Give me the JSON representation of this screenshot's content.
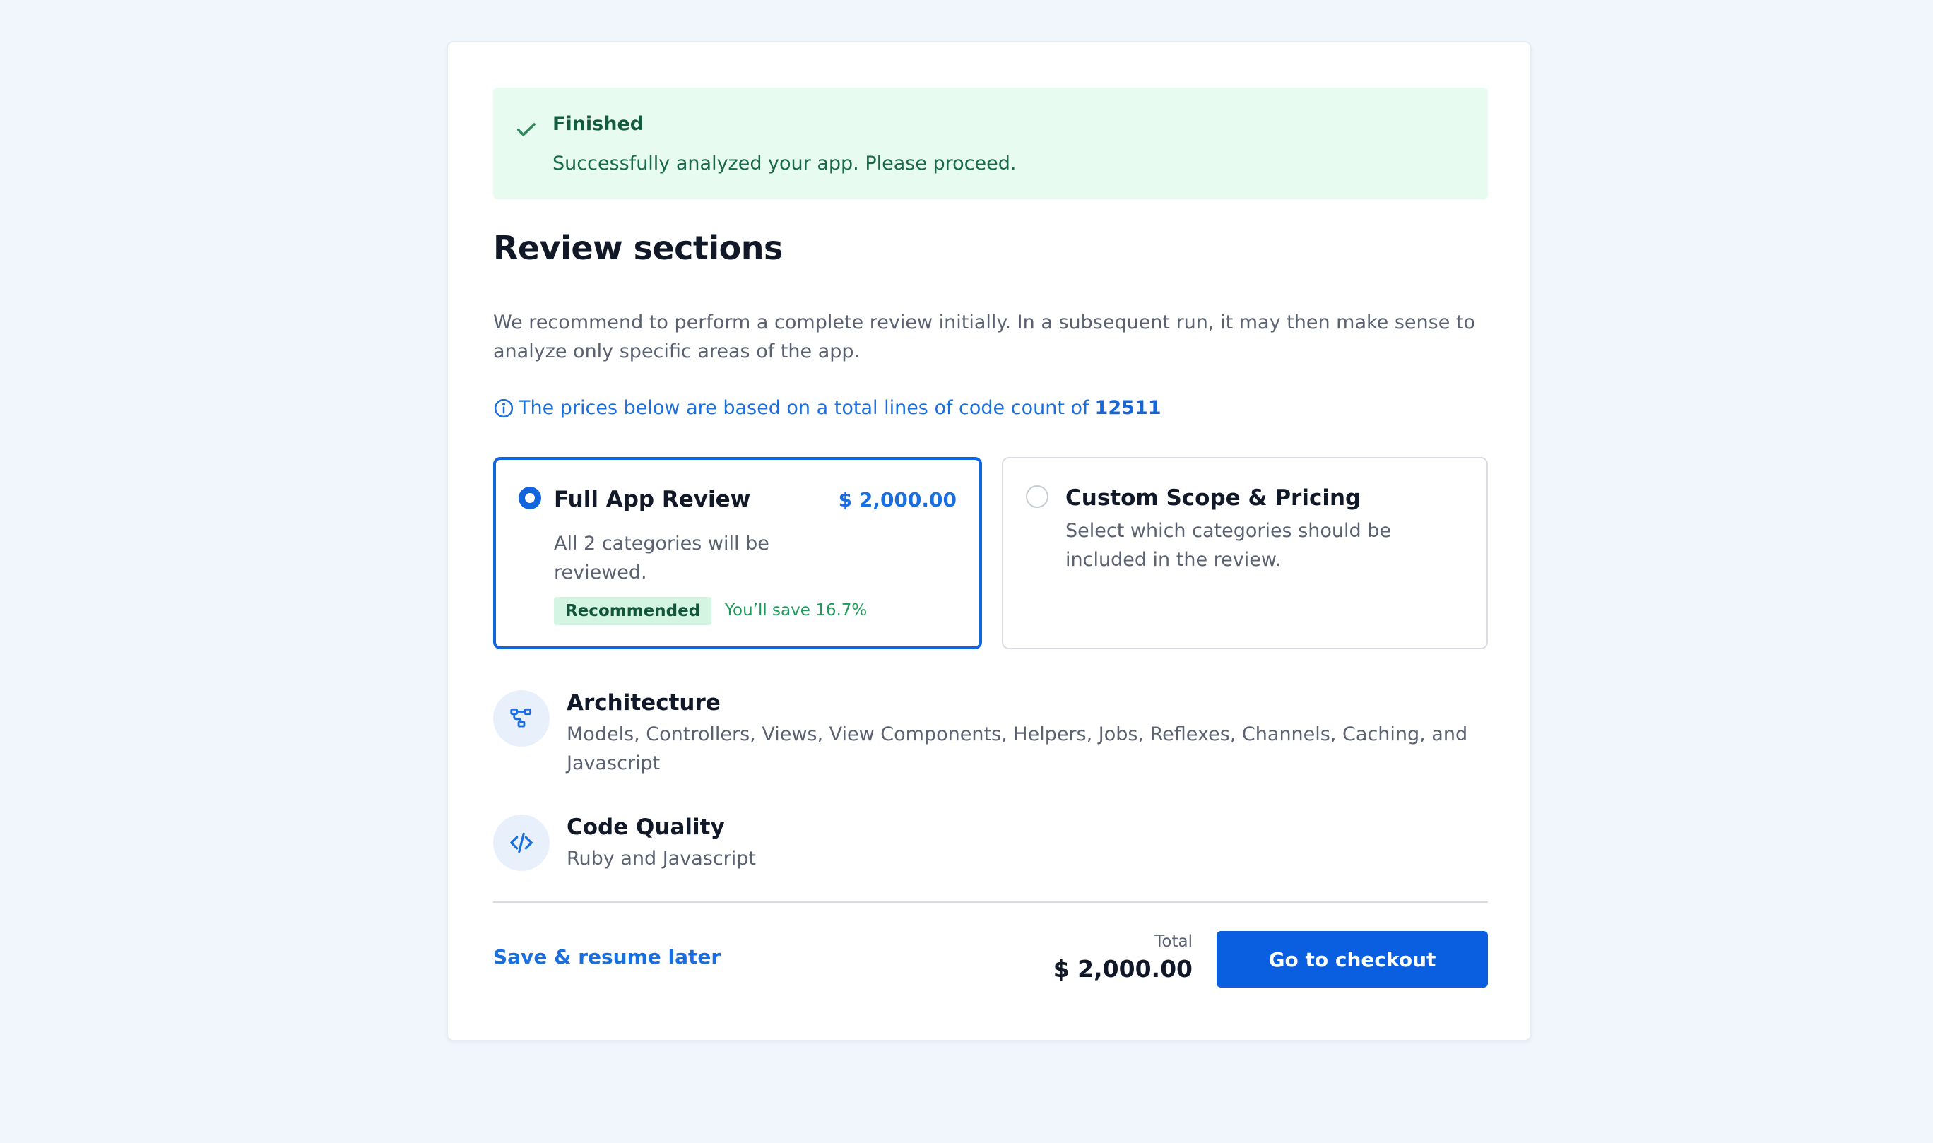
{
  "alert": {
    "title": "Finished",
    "message": "Successfully analyzed your app. Please proceed."
  },
  "page": {
    "title": "Review sections",
    "description": "We recommend to perform a complete review initially. In a subsequent run, it may then make sense to analyze only specific areas of the app.",
    "info_text": "The prices below are based on a total lines of code count of",
    "info_count": "12511"
  },
  "options": {
    "full": {
      "title": "Full App Review",
      "price": "$ 2,000.00",
      "description": "All 2 categories will be reviewed.",
      "badge": "Recommended",
      "savings": "You’ll save 16.7%",
      "selected": true
    },
    "custom": {
      "title": "Custom Scope & Pricing",
      "description": "Select which categories should be included in the review.",
      "selected": false
    }
  },
  "categories": [
    {
      "name": "Architecture",
      "description": "Models, Controllers, Views, View Components, Helpers, Jobs, Reflexes, Channels, Caching, and Javascript",
      "icon": "hierarchy-icon"
    },
    {
      "name": "Code Quality",
      "description": "Ruby and Javascript",
      "icon": "code-icon"
    }
  ],
  "footer": {
    "resume_label": "Save & resume later",
    "total_label": "Total",
    "total_value": "$ 2,000.00",
    "checkout_label": "Go to checkout"
  },
  "colors": {
    "accent": "#0a5fe0",
    "success_bg": "#e8fbf0",
    "success_text": "#155c3f"
  }
}
